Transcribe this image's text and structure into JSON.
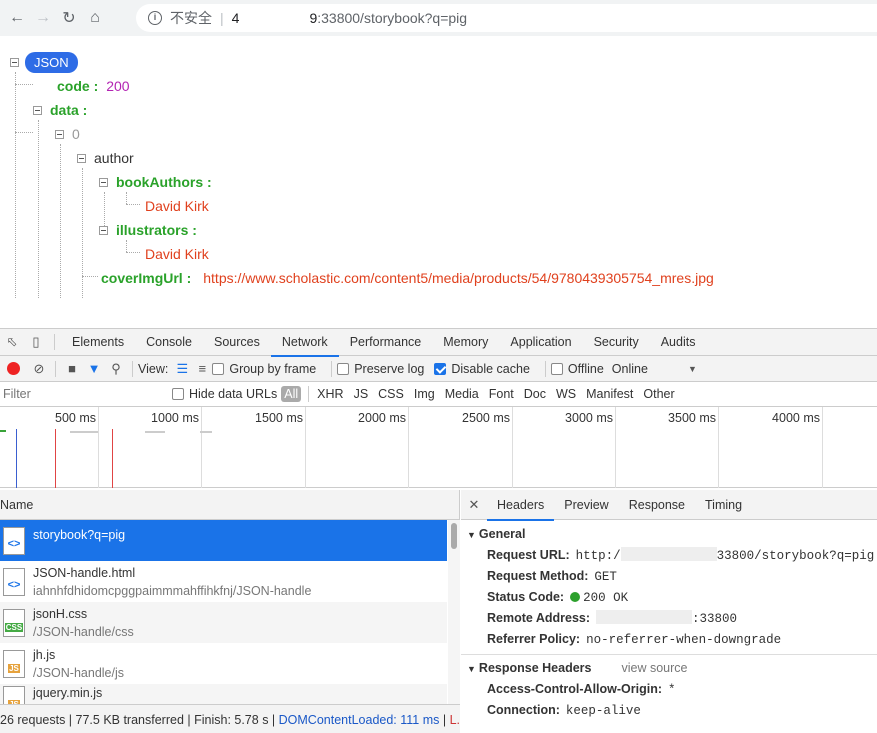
{
  "browser": {
    "insecure_label": "不安全",
    "separator": "|",
    "url_host_start": "4",
    "url_host_end": "9",
    "url_path": ":33800/storybook?q=pig"
  },
  "json_view": {
    "root_label": "JSON",
    "code_key": "code :",
    "code_value": "200",
    "data_key": "data :",
    "index0": "0",
    "author_key": "author",
    "book_authors_key": "bookAuthors :",
    "book_authors_value": "David Kirk",
    "illustrators_key": "illustrators :",
    "illustrators_value": "David Kirk",
    "cover_key": "coverImgUrl :",
    "cover_value": "https://www.scholastic.com/content5/media/products/54/9780439305754_mres.jpg"
  },
  "devtools": {
    "tabs": [
      "Elements",
      "Console",
      "Sources",
      "Network",
      "Performance",
      "Memory",
      "Application",
      "Security",
      "Audits"
    ],
    "active_tab": "Network",
    "toolbar": {
      "view_label": "View:",
      "group_by_frame": "Group by frame",
      "preserve_log": "Preserve log",
      "disable_cache": "Disable cache",
      "offline": "Offline",
      "throttle": "Online",
      "disable_cache_checked": true
    },
    "filter": {
      "placeholder": "Filter",
      "hide_data_urls": "Hide data URLs",
      "types": [
        "All",
        "XHR",
        "JS",
        "CSS",
        "Img",
        "Media",
        "Font",
        "Doc",
        "WS",
        "Manifest",
        "Other"
      ]
    },
    "timeline_ticks": [
      "500 ms",
      "1000 ms",
      "1500 ms",
      "2000 ms",
      "2500 ms",
      "3000 ms",
      "3500 ms",
      "4000 ms"
    ],
    "requests_header": "Name",
    "requests": [
      {
        "name": "storybook?q=pig",
        "sub": "",
        "icon": "doc-icon"
      },
      {
        "name": "JSON-handle.html",
        "sub": "iahnhfdhidomcpggpaimmmahffihkfnj/JSON-handle",
        "icon": "doc-icon"
      },
      {
        "name": "jsonH.css",
        "sub": "/JSON-handle/css",
        "icon": "css-icon"
      },
      {
        "name": "jh.js",
        "sub": "/JSON-handle/js",
        "icon": "js-icon"
      },
      {
        "name": "jquery.min.js",
        "sub": "",
        "icon": "js-icon"
      }
    ],
    "summary": {
      "stats": "26 requests | 77.5 KB transferred | Finish: 5.78 s | ",
      "dcl": "DOMContentLoaded: 111 ms",
      "sep": " | ",
      "load": "L..."
    },
    "detail": {
      "tabs": [
        "Headers",
        "Preview",
        "Response",
        "Timing"
      ],
      "active_tab": "Headers",
      "general_title": "General",
      "request_url_label": "Request URL:",
      "request_url_prefix": "http:/",
      "request_url_suffix": "33800/storybook?q=pig",
      "request_method_label": "Request Method:",
      "request_method": "GET",
      "status_code_label": "Status Code:",
      "status_code": "200 OK",
      "remote_address_label": "Remote Address:",
      "remote_address_suffix": ":33800",
      "referrer_policy_label": "Referrer Policy:",
      "referrer_policy": "no-referrer-when-downgrade",
      "response_headers_title": "Response Headers",
      "view_source": "view source",
      "acao_label": "Access-Control-Allow-Origin:",
      "acao_value": "*",
      "connection_label": "Connection:",
      "connection_value": "keep-alive"
    }
  }
}
